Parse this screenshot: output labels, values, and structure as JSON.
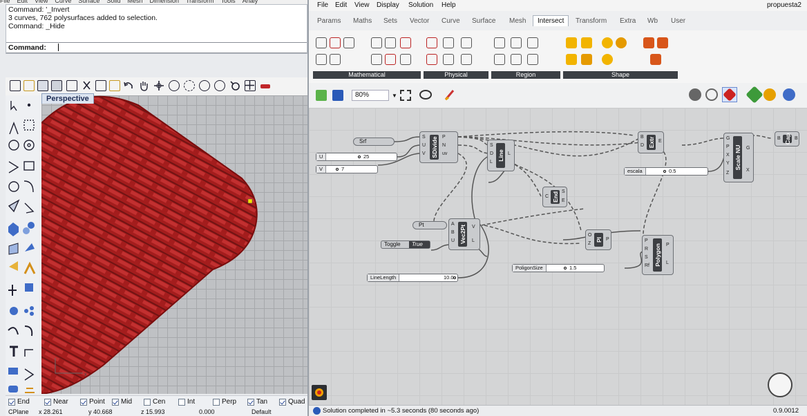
{
  "rhino": {
    "menu": [
      "File",
      "Edit",
      "View",
      "Curve",
      "Surface",
      "Solid",
      "Mesh",
      "Dimension",
      "Transform",
      "Tools",
      "Analy"
    ],
    "command_history": [
      "Command: '_Invert",
      "3 curves, 762 polysurfaces added to selection.",
      "Command: _Hide"
    ],
    "command_prompt": "Command:",
    "viewport_name": "Perspective",
    "osnaps": [
      {
        "label": "End",
        "checked": true
      },
      {
        "label": "Near",
        "checked": true
      },
      {
        "label": "Point",
        "checked": true
      },
      {
        "label": "Mid",
        "checked": true
      },
      {
        "label": "Cen",
        "checked": false
      },
      {
        "label": "Int",
        "checked": false
      },
      {
        "label": "Perp",
        "checked": false
      },
      {
        "label": "Tan",
        "checked": true
      },
      {
        "label": "Quad",
        "checked": true
      }
    ],
    "status": {
      "cplane": "CPlane",
      "x": "x 28.261",
      "y": "y 40.668",
      "z": "z 15.993",
      "dist": "0.000",
      "layer": "Default"
    }
  },
  "gh": {
    "menu": [
      "File",
      "Edit",
      "View",
      "Display",
      "Solution",
      "Help"
    ],
    "doc_title": "propuesta2",
    "tabs": [
      "Params",
      "Maths",
      "Sets",
      "Vector",
      "Curve",
      "Surface",
      "Mesh",
      "Intersect",
      "Transform",
      "Extra",
      "Wb",
      "User"
    ],
    "active_tab": "Intersect",
    "ribbon_groups": [
      "Mathematical",
      "Physical",
      "Region",
      "Shape"
    ],
    "zoom": "80%",
    "components": {
      "sdivide": {
        "name": "SDivide",
        "inputs": [
          "S",
          "U",
          "V"
        ],
        "outputs": [
          "P",
          "N",
          "uv"
        ]
      },
      "line": {
        "name": "Line",
        "inputs": [
          "S",
          "D",
          "L"
        ],
        "outputs": [
          "L"
        ]
      },
      "extr": {
        "name": "Extr",
        "inputs": [
          "B",
          "D"
        ],
        "outputs": [
          "E"
        ]
      },
      "scale": {
        "name": "Scale NU",
        "inputs": [
          "G",
          "P",
          "X",
          "Y",
          "Z"
        ],
        "outputs": [
          "G",
          "X"
        ]
      },
      "cap": {
        "name": "Cap",
        "inputs": [
          "B"
        ],
        "outputs": [
          "B"
        ]
      },
      "end": {
        "name": "End",
        "inputs": [
          "C"
        ],
        "outputs": [
          "S",
          "E"
        ]
      },
      "vec2pt": {
        "name": "Vec2Pt",
        "inputs": [
          "A",
          "B",
          "U"
        ],
        "outputs": [
          "V",
          "L"
        ]
      },
      "pl": {
        "name": "Pl",
        "inputs": [
          "O",
          "Z"
        ],
        "outputs": [
          "P"
        ]
      },
      "polygon": {
        "name": "Polygon",
        "inputs": [
          "P",
          "R",
          "S",
          "Rf"
        ],
        "outputs": [
          "P",
          "L"
        ]
      }
    },
    "params": {
      "srf": "Srf",
      "pt": "Pt"
    },
    "sliders": {
      "u": {
        "label": "U",
        "value": "25"
      },
      "v": {
        "label": "V",
        "value": "7"
      },
      "escala": {
        "label": "escala",
        "value": "0.5"
      },
      "poligonsize": {
        "label": "PoligonSize",
        "value": "1.5"
      },
      "linelength": {
        "label": "LineLength",
        "value": "10.0"
      }
    },
    "toggle": {
      "label": "Toggle",
      "value": "True"
    },
    "status_message": "Solution completed in ~5.3 seconds (80 seconds ago)",
    "version": "0.9.0012"
  },
  "colors": {
    "geometry_red": "#a31616",
    "wire": "#555555",
    "component_core": "#3d3f43"
  }
}
